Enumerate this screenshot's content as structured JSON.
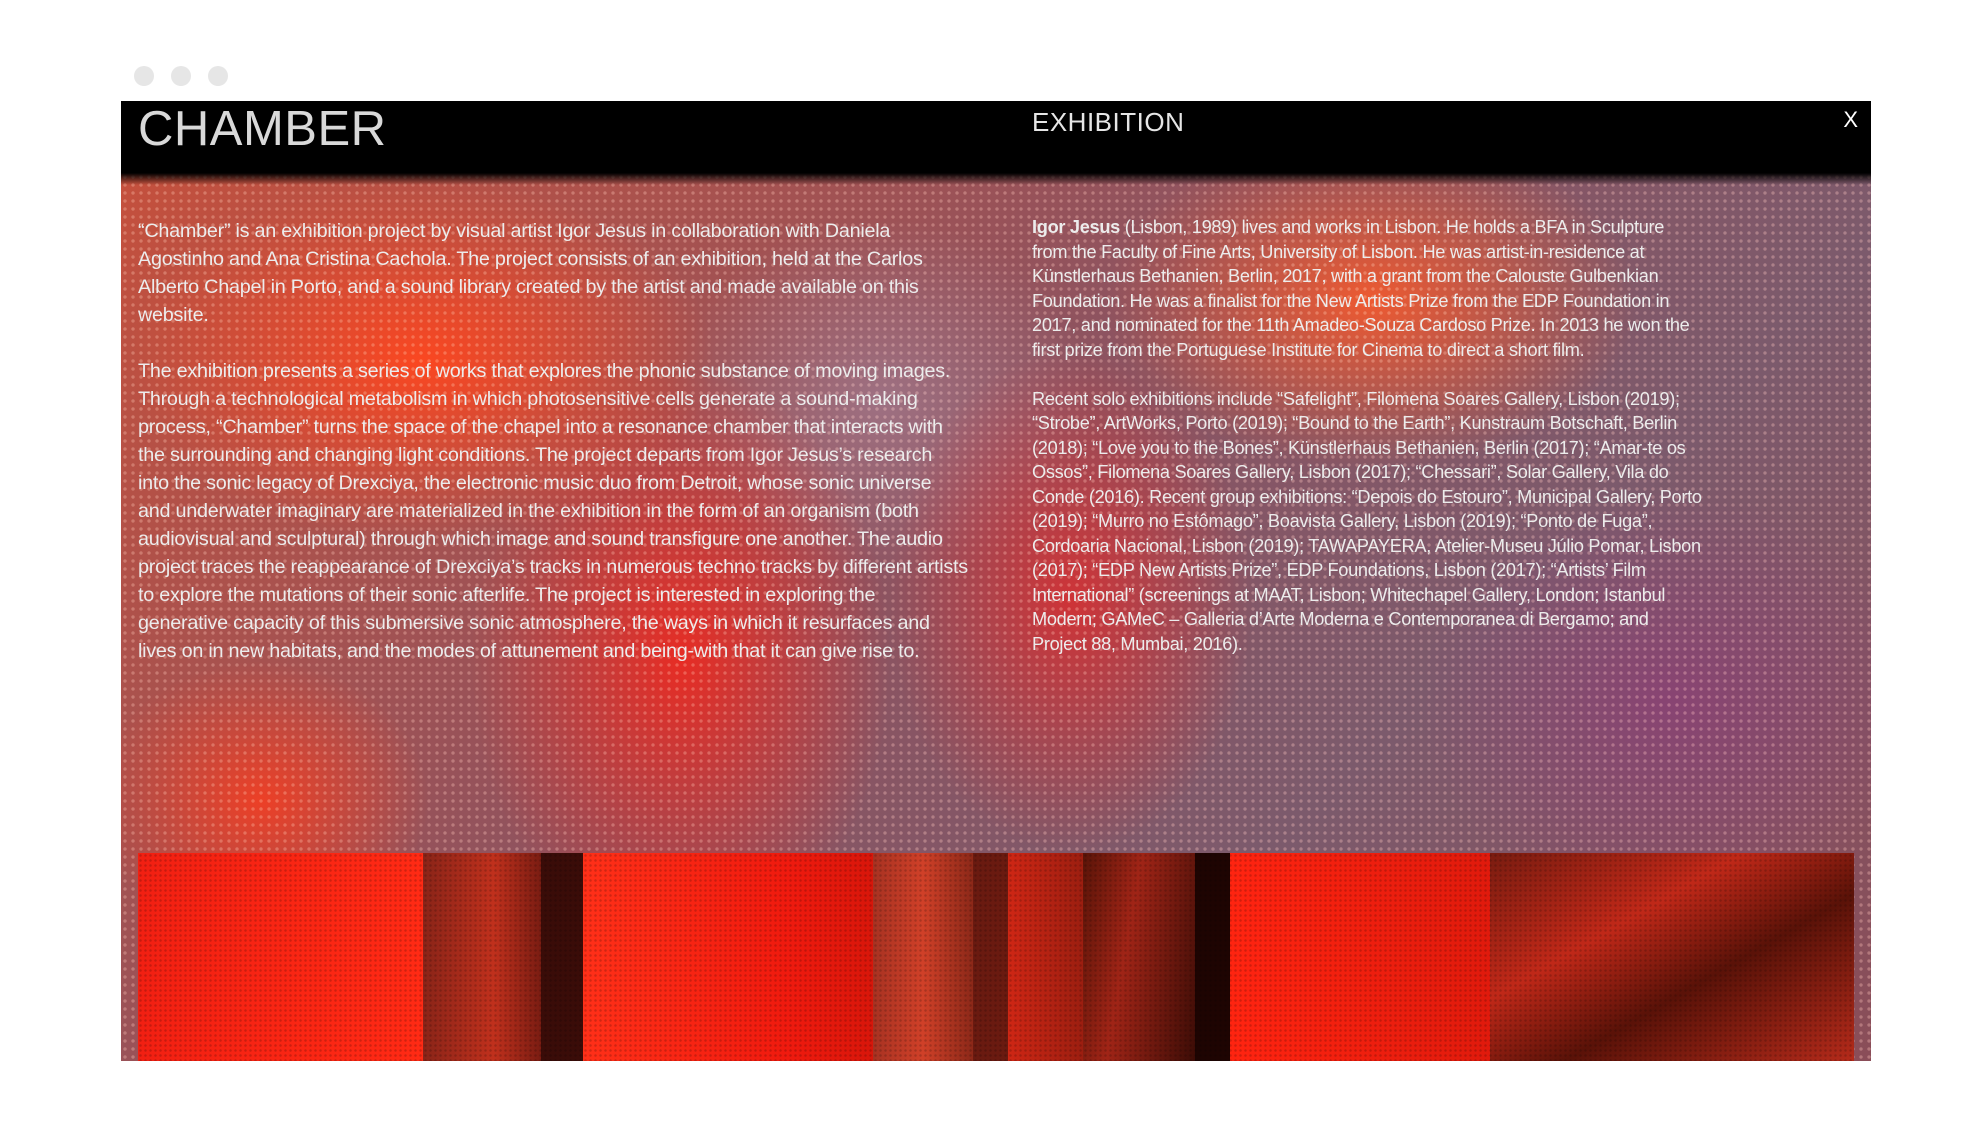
{
  "browser": {
    "dots": [
      "close",
      "minimize",
      "maximize"
    ]
  },
  "header": {
    "title": "CHAMBER",
    "section": "EXHIBITION",
    "close_label": "X"
  },
  "left_column": {
    "paragraphs": [
      "“Chamber” is an exhibition project by visual artist Igor Jesus in collaboration with Daniela Agostinho and Ana Cristina Cachola. The project consists of an exhibition, held at the Carlos Alberto Chapel in Porto, and a sound library created by the artist and made available on this website.",
      "The exhibition presents a series of works that explores the phonic substance of moving images. Through a technological metabolism in which photosensitive cells generate a sound-making process, “Chamber” turns the space of the chapel into a resonance chamber that interacts with the surrounding and changing light conditions. The project departs from Igor Jesus’s research into the sonic legacy of Drexciya, the electronic music duo from Detroit, whose sonic universe and underwater imaginary are materialized in the exhibition in the form of an organism (both audiovisual and sculptural) through which image and sound transfigure one another. The audio project traces the reappearance of Drexciya’s tracks in numerous techno tracks by different artists to explore the mutations of their sonic afterlife. The project is interested in exploring the generative capacity of this submersive sonic atmosphere, the ways in which it resurfaces and lives on in new habitats, and the modes of attunement and being-with that it can give rise to."
    ]
  },
  "right_column": {
    "bio_name": "Igor Jesus",
    "bio_text": " (Lisbon, 1989) lives and works in Lisbon. He holds a BFA in Sculpture from the Faculty of Fine Arts, University of Lisbon. He was artist-in-residence at Künstlerhaus Bethanien, Berlin, 2017, with a grant from the Calouste Gulbenkian Foundation. He was a finalist for the New Artists Prize from the EDP Foundation in 2017, and nominated for the 11th Amadeo-Souza Cardoso Prize. In 2013 he won the first prize from the Portuguese Institute for Cinema to direct a short film.",
    "exhibitions": "Recent solo exhibitions include “Safelight”, Filomena Soares Gallery, Lisbon (2019); “Strobe”, ArtWorks, Porto (2019); “Bound to the Earth”, Kunstraum Botschaft, Berlin (2018); “Love you to the Bones”, Künstlerhaus Bethanien, Berlin (2017); “Amar-te os Ossos”, Filomena Soares Gallery, Lisbon (2017); “Chessari”, Solar Gallery, Vila do Conde (2016). Recent group exhibitions: “Depois do Estouro”, Municipal Gallery, Porto (2019); “Murro no Estômago”, Boavista Gallery, Lisbon (2019); “Ponto de Fuga”, Cordoaria Nacional, Lisbon (2019); TAWAPAYERA, Atelier-Museu Júlio Pomar, Lisbon (2017); “EDP New Artists Prize”, EDP Foundations, Lisbon (2017); “Artists’ Film International” (screenings at MAAT, Lisbon; Whitechapel Gallery, London; Istanbul Modern; GAMeC – Galleria d’Arte Moderna e Contemporanea di Bergamo; and Project 88, Mumbai, 2016)."
  },
  "colors": {
    "header_bg": "#000000",
    "accent_red": "#ff2410",
    "text": "#ececec"
  }
}
